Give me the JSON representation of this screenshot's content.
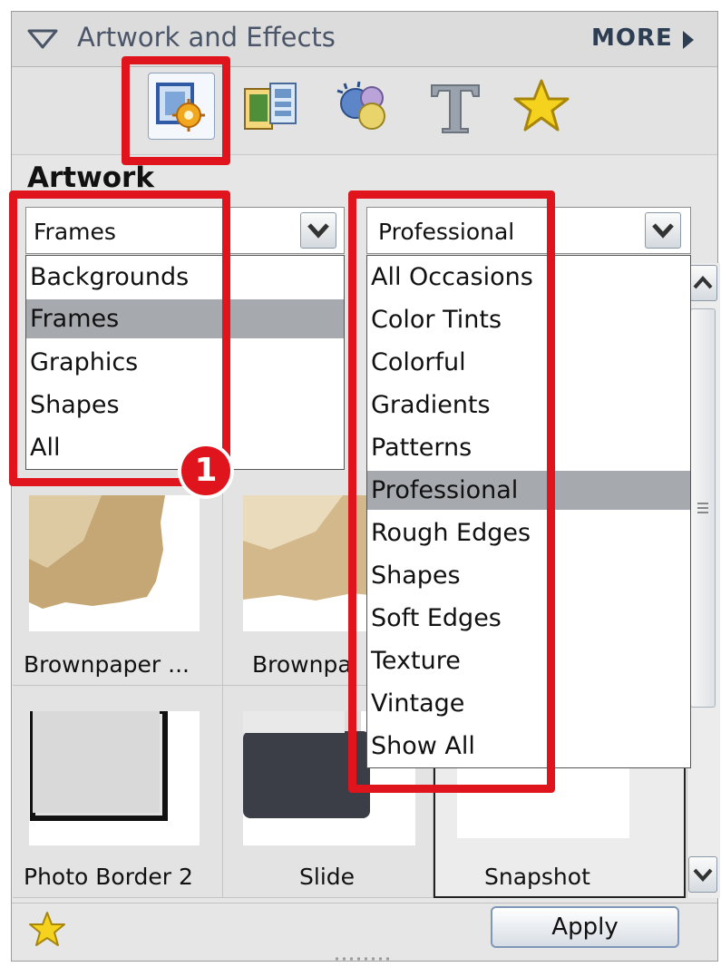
{
  "header": {
    "title": "Artwork and Effects",
    "more_label": "MORE"
  },
  "toolbar": {
    "icons": [
      "artwork-icon",
      "photo-effects-icon",
      "effects-icon",
      "text-icon",
      "favorites-icon"
    ]
  },
  "artwork_heading": "Artwork",
  "category_select": {
    "value": "Frames",
    "options": [
      "Backgrounds",
      "Frames",
      "Graphics",
      "Shapes",
      "All"
    ],
    "selected": "Frames"
  },
  "style_select": {
    "value": "Professional",
    "options": [
      "All Occasions",
      "Color Tints",
      "Colorful",
      "Gradients",
      "Patterns",
      "Professional",
      "Rough Edges",
      "Shapes",
      "Soft Edges",
      "Texture",
      "Vintage",
      "Show All"
    ],
    "selected": "Professional"
  },
  "callout_number": "1",
  "thumbnails": [
    {
      "caption": "Brownpaper ..."
    },
    {
      "caption": "Brownpa"
    },
    {
      "caption": "Photo Border 2"
    },
    {
      "caption": "Slide"
    },
    {
      "caption": "Snapshot"
    }
  ],
  "footer": {
    "apply_label": "Apply"
  },
  "colors": {
    "highlight": "#e0141c",
    "selection": "#a6a9ad",
    "panel": "#e6e6e6"
  }
}
